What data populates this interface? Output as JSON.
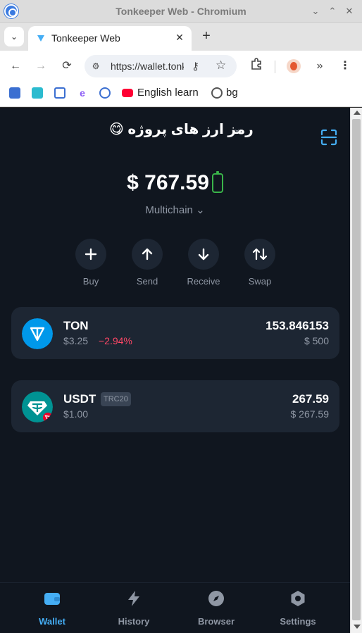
{
  "window": {
    "title": "Tonkeeper Web - Chromium",
    "controls": {
      "minimize": "⌄",
      "maximize": "⌃",
      "close": "✕"
    }
  },
  "tabs": [
    {
      "title": "Tonkeeper Web",
      "close": "✕"
    }
  ],
  "newtab": "+",
  "toolbar": {
    "url": "https://wallet.tonkeeper.com",
    "back": "←",
    "forward": "→",
    "reload": "⟳",
    "overflow": "»",
    "menu": "⋮"
  },
  "bookmarks": [
    {
      "label": "",
      "icon": "arrow-icon"
    },
    {
      "label": "",
      "icon": "info-icon"
    },
    {
      "label": "",
      "icon": "shield-icon"
    },
    {
      "label": "",
      "icon": "e-icon"
    },
    {
      "label": "",
      "icon": "circle-icon"
    },
    {
      "label": "English learn",
      "icon": "youtube-icon"
    },
    {
      "label": "bg",
      "icon": "globe-icon"
    }
  ],
  "wallet": {
    "name": "رمز ارز های پروژه",
    "emoji": "😋",
    "balance": "$ 767.59",
    "chain": "Multichain"
  },
  "actions": [
    {
      "label": "Buy",
      "icon": "plus-icon"
    },
    {
      "label": "Send",
      "icon": "arrow-up-icon"
    },
    {
      "label": "Receive",
      "icon": "arrow-down-icon"
    },
    {
      "label": "Swap",
      "icon": "swap-icon"
    }
  ],
  "assets": [
    {
      "name": "TON",
      "price": "$3.25",
      "change": "−2.94%",
      "amount": "153.846153",
      "fiat": "$ 500",
      "tag": ""
    },
    {
      "name": "USDT",
      "price": "$1.00",
      "change": "",
      "amount": "267.59",
      "fiat": "$ 267.59",
      "tag": "TRC20"
    }
  ],
  "nav": [
    {
      "label": "Wallet",
      "icon": "wallet-icon",
      "active": true
    },
    {
      "label": "History",
      "icon": "lightning-icon",
      "active": false
    },
    {
      "label": "Browser",
      "icon": "compass-icon",
      "active": false
    },
    {
      "label": "Settings",
      "icon": "gear-icon",
      "active": false
    }
  ],
  "colors": {
    "background": "#10161f",
    "card": "#1d2633",
    "accent": "#45aef5",
    "negative": "#ff4766",
    "ton": "#0098ea",
    "usdt": "#009393"
  }
}
